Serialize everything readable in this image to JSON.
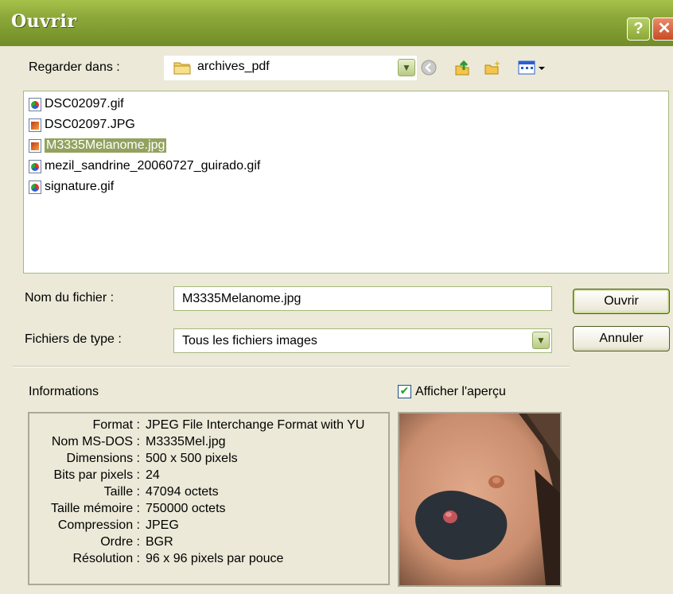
{
  "window": {
    "title": "Ouvrir",
    "help_label": "?",
    "close_label": "✕"
  },
  "lookin": {
    "label": "Regarder dans :",
    "folder": "archives_pdf"
  },
  "toolbar": {
    "icons": [
      "back-icon",
      "up-folder-icon",
      "new-folder-icon",
      "view-menu-icon"
    ]
  },
  "files": [
    {
      "name": "DSC02097.gif",
      "type": "gif",
      "selected": false
    },
    {
      "name": "DSC02097.JPG",
      "type": "jpg",
      "selected": false
    },
    {
      "name": "M3335Melanome.jpg",
      "type": "jpg",
      "selected": true
    },
    {
      "name": "mezil_sandrine_20060727_guirado.gif",
      "type": "gif",
      "selected": false
    },
    {
      "name": "signature.gif",
      "type": "gif",
      "selected": false
    }
  ],
  "filename": {
    "label": "Nom du fichier :",
    "value": "M3335Melanome.jpg"
  },
  "filetype": {
    "label": "Fichiers de type :",
    "value": "Tous les fichiers images"
  },
  "buttons": {
    "open": "Ouvrir",
    "cancel": "Annuler"
  },
  "informations": {
    "heading": "Informations",
    "rows": [
      {
        "key": "Format :",
        "value": "JPEG File Interchange Format with YU"
      },
      {
        "key": "Nom MS-DOS :",
        "value": "M3335Mel.jpg"
      },
      {
        "key": "Dimensions :",
        "value": "500 x 500 pixels"
      },
      {
        "key": "Bits par pixels :",
        "value": "24"
      },
      {
        "key": "Taille :",
        "value": "47094 octets"
      },
      {
        "key": "Taille mémoire :",
        "value": "750000 octets"
      },
      {
        "key": "Compression :",
        "value": "JPEG"
      },
      {
        "key": "Ordre :",
        "value": "BGR"
      },
      {
        "key": "Résolution :",
        "value": "96 x 96 pixels par pouce"
      }
    ]
  },
  "preview": {
    "checkbox_label": "Afficher l'aperçu",
    "checked": true
  },
  "colors": {
    "titlebar": "#8ea93a",
    "selection": "#93a25f",
    "dialog_bg": "#ece9d8"
  }
}
